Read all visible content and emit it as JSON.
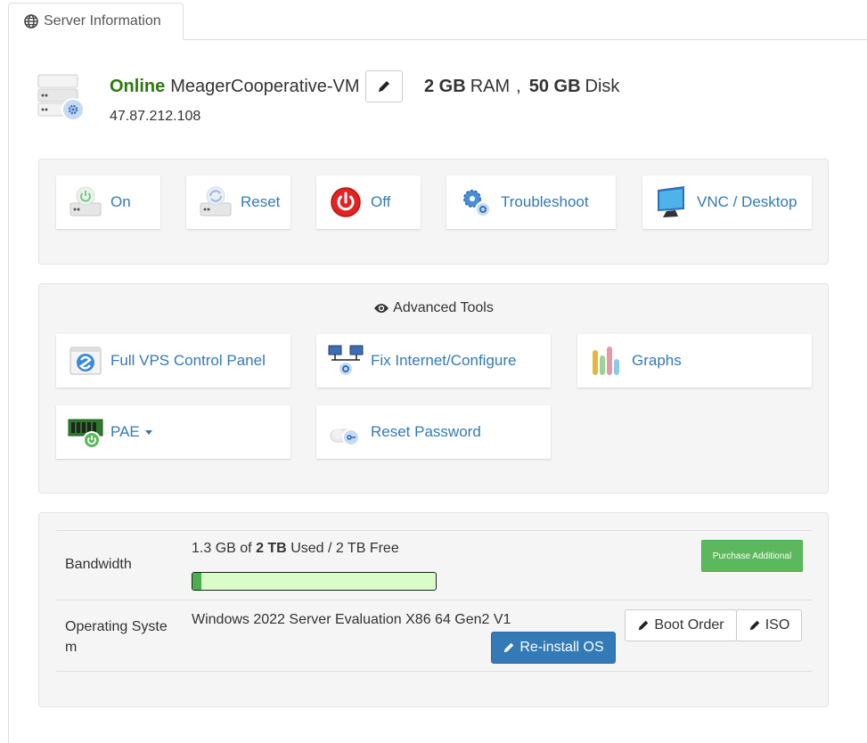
{
  "tab": {
    "label": "Server Information",
    "icon": "globe-icon"
  },
  "server": {
    "status": "Online",
    "name": "MeagerCooperative-VM",
    "ip": "47.87.212.108",
    "ram_value": "2 GB",
    "ram_unit": "RAM",
    "separator": ",",
    "disk_value": "50 GB",
    "disk_unit": "Disk",
    "status_color": "#2b7a0b"
  },
  "power_actions": [
    {
      "label": "On",
      "icon": "power-on-server-icon"
    },
    {
      "label": "Reset",
      "icon": "reset-server-icon"
    },
    {
      "label": "Off",
      "icon": "power-off-icon"
    },
    {
      "label": "Troubleshoot",
      "icon": "troubleshoot-gears-icon"
    },
    {
      "label": "VNC / Desktop",
      "icon": "monitor-icon"
    }
  ],
  "advanced": {
    "title": "Advanced Tools",
    "tools": [
      {
        "label": "Full VPS Control Panel",
        "icon": "control-panel-icon"
      },
      {
        "label": "Fix Internet/Configure",
        "icon": "network-icon"
      },
      {
        "label": "Graphs",
        "icon": "bar-graph-icon"
      },
      {
        "label": "PAE",
        "icon": "memory-chip-icon"
      },
      {
        "label": "Reset Password",
        "icon": "key-reset-icon"
      }
    ]
  },
  "bandwidth": {
    "label": "Bandwidth",
    "used": "1.3 GB",
    "of": "of",
    "total": "2 TB",
    "suffix": "Used / 2 TB Free",
    "used_fraction": 0.035,
    "purchase_label": "Purchase Additional"
  },
  "os": {
    "label": "Operating System",
    "value": "Windows 2022 Server Evaluation X86 64 Gen2 V1",
    "reinstall_label": "Re-install OS",
    "boot_order_label": "Boot Order",
    "iso_label": "ISO"
  },
  "colors": {
    "link": "#337ab7",
    "primary": "#337ab7",
    "success": "#5cb85c",
    "bar_bg": "#d9fcc9"
  }
}
